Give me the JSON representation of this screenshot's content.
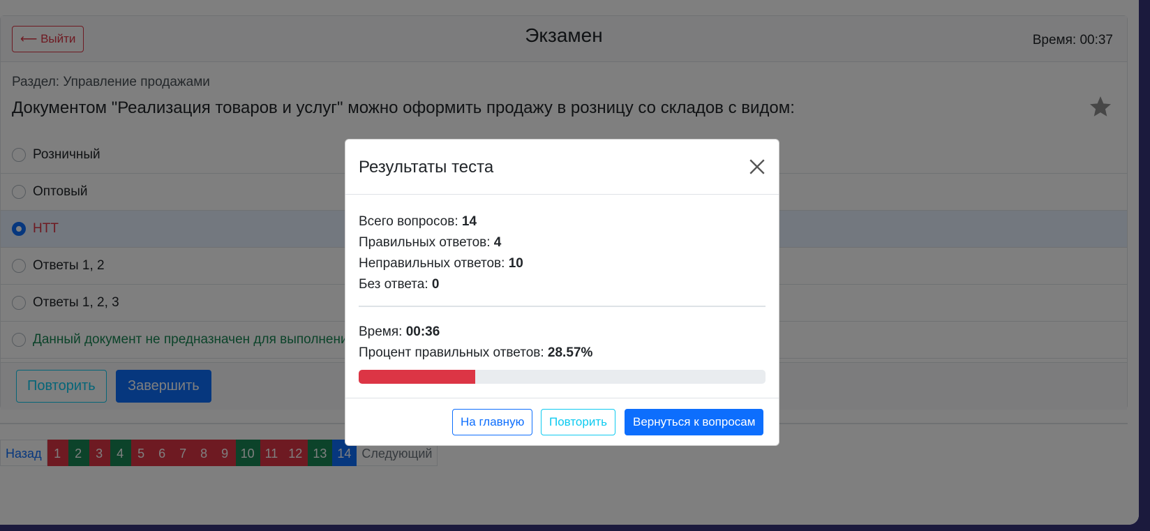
{
  "header": {
    "exit_label": "⟵ Выйти",
    "title": "Экзамен",
    "timer": "Время: 00:37"
  },
  "question": {
    "section": "Раздел: Управление продажами",
    "text": "Документом \"Реализация товаров и услуг\" можно оформить продажу в розницу со складов с видом:",
    "answers": [
      {
        "label": "Розничный"
      },
      {
        "label": "Оптовый"
      },
      {
        "label": "НТТ"
      },
      {
        "label": "Ответы 1, 2"
      },
      {
        "label": "Ответы 1, 2, 3"
      },
      {
        "label": "Данный документ не предназначен для выполнения продажи в розницу"
      }
    ],
    "selected_index": 2
  },
  "actions": {
    "retry_label": "Повторить",
    "finish_label": "Завершить"
  },
  "pagination": {
    "prev_label": "Назад",
    "next_label": "Следующий",
    "pages": [
      {
        "label": "1",
        "status": "wrong"
      },
      {
        "label": "2",
        "status": "correct"
      },
      {
        "label": "3",
        "status": "wrong"
      },
      {
        "label": "4",
        "status": "correct"
      },
      {
        "label": "5",
        "status": "wrong"
      },
      {
        "label": "6",
        "status": "wrong"
      },
      {
        "label": "7",
        "status": "wrong"
      },
      {
        "label": "8",
        "status": "wrong"
      },
      {
        "label": "9",
        "status": "wrong"
      },
      {
        "label": "10",
        "status": "correct"
      },
      {
        "label": "11",
        "status": "wrong"
      },
      {
        "label": "12",
        "status": "wrong"
      },
      {
        "label": "13",
        "status": "correct"
      },
      {
        "label": "14",
        "status": "active"
      }
    ]
  },
  "modal": {
    "title": "Результаты теста",
    "total_label": "Всего вопросов:",
    "total_value": "14",
    "correct_label": "Правильных ответов:",
    "correct_value": "4",
    "wrong_label": "Неправильных ответов:",
    "wrong_value": "10",
    "unanswered_label": "Без ответа:",
    "unanswered_value": "0",
    "time_label": "Время:",
    "time_value": "00:36",
    "percent_label": "Процент правильных ответов:",
    "percent_value": "28.57%",
    "progress_fraction": 0.2857,
    "home_label": "На главную",
    "retry_label": "Повторить",
    "back_label": "Вернуться к вопросам"
  },
  "colors": {
    "primary": "#0d6efd",
    "danger": "#dc3545",
    "success": "#198754",
    "info": "#0dcaf0"
  },
  "icons": {
    "favorite": "star-icon",
    "close": "close-icon"
  }
}
